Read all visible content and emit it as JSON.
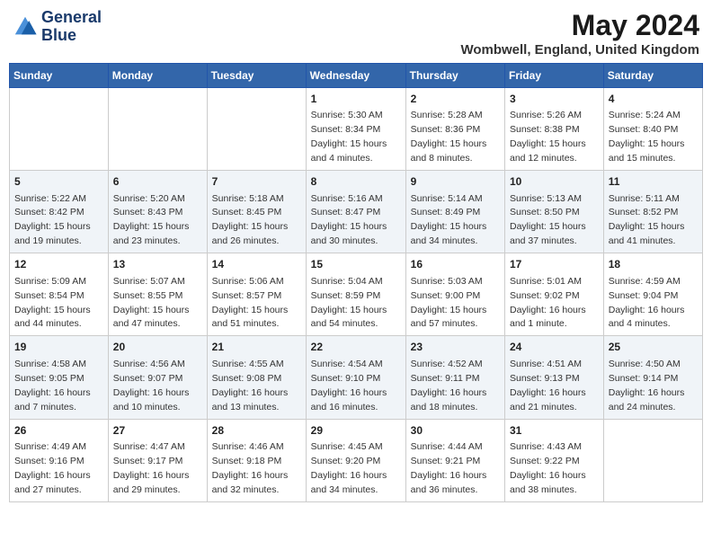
{
  "logo": {
    "line1": "General",
    "line2": "Blue"
  },
  "title": "May 2024",
  "subtitle": "Wombwell, England, United Kingdom",
  "days_of_week": [
    "Sunday",
    "Monday",
    "Tuesday",
    "Wednesday",
    "Thursday",
    "Friday",
    "Saturday"
  ],
  "weeks": [
    [
      {
        "day": null,
        "info": null
      },
      {
        "day": null,
        "info": null
      },
      {
        "day": null,
        "info": null
      },
      {
        "day": "1",
        "info": "Sunrise: 5:30 AM\nSunset: 8:34 PM\nDaylight: 15 hours\nand 4 minutes."
      },
      {
        "day": "2",
        "info": "Sunrise: 5:28 AM\nSunset: 8:36 PM\nDaylight: 15 hours\nand 8 minutes."
      },
      {
        "day": "3",
        "info": "Sunrise: 5:26 AM\nSunset: 8:38 PM\nDaylight: 15 hours\nand 12 minutes."
      },
      {
        "day": "4",
        "info": "Sunrise: 5:24 AM\nSunset: 8:40 PM\nDaylight: 15 hours\nand 15 minutes."
      }
    ],
    [
      {
        "day": "5",
        "info": "Sunrise: 5:22 AM\nSunset: 8:42 PM\nDaylight: 15 hours\nand 19 minutes."
      },
      {
        "day": "6",
        "info": "Sunrise: 5:20 AM\nSunset: 8:43 PM\nDaylight: 15 hours\nand 23 minutes."
      },
      {
        "day": "7",
        "info": "Sunrise: 5:18 AM\nSunset: 8:45 PM\nDaylight: 15 hours\nand 26 minutes."
      },
      {
        "day": "8",
        "info": "Sunrise: 5:16 AM\nSunset: 8:47 PM\nDaylight: 15 hours\nand 30 minutes."
      },
      {
        "day": "9",
        "info": "Sunrise: 5:14 AM\nSunset: 8:49 PM\nDaylight: 15 hours\nand 34 minutes."
      },
      {
        "day": "10",
        "info": "Sunrise: 5:13 AM\nSunset: 8:50 PM\nDaylight: 15 hours\nand 37 minutes."
      },
      {
        "day": "11",
        "info": "Sunrise: 5:11 AM\nSunset: 8:52 PM\nDaylight: 15 hours\nand 41 minutes."
      }
    ],
    [
      {
        "day": "12",
        "info": "Sunrise: 5:09 AM\nSunset: 8:54 PM\nDaylight: 15 hours\nand 44 minutes."
      },
      {
        "day": "13",
        "info": "Sunrise: 5:07 AM\nSunset: 8:55 PM\nDaylight: 15 hours\nand 47 minutes."
      },
      {
        "day": "14",
        "info": "Sunrise: 5:06 AM\nSunset: 8:57 PM\nDaylight: 15 hours\nand 51 minutes."
      },
      {
        "day": "15",
        "info": "Sunrise: 5:04 AM\nSunset: 8:59 PM\nDaylight: 15 hours\nand 54 minutes."
      },
      {
        "day": "16",
        "info": "Sunrise: 5:03 AM\nSunset: 9:00 PM\nDaylight: 15 hours\nand 57 minutes."
      },
      {
        "day": "17",
        "info": "Sunrise: 5:01 AM\nSunset: 9:02 PM\nDaylight: 16 hours\nand 1 minute."
      },
      {
        "day": "18",
        "info": "Sunrise: 4:59 AM\nSunset: 9:04 PM\nDaylight: 16 hours\nand 4 minutes."
      }
    ],
    [
      {
        "day": "19",
        "info": "Sunrise: 4:58 AM\nSunset: 9:05 PM\nDaylight: 16 hours\nand 7 minutes."
      },
      {
        "day": "20",
        "info": "Sunrise: 4:56 AM\nSunset: 9:07 PM\nDaylight: 16 hours\nand 10 minutes."
      },
      {
        "day": "21",
        "info": "Sunrise: 4:55 AM\nSunset: 9:08 PM\nDaylight: 16 hours\nand 13 minutes."
      },
      {
        "day": "22",
        "info": "Sunrise: 4:54 AM\nSunset: 9:10 PM\nDaylight: 16 hours\nand 16 minutes."
      },
      {
        "day": "23",
        "info": "Sunrise: 4:52 AM\nSunset: 9:11 PM\nDaylight: 16 hours\nand 18 minutes."
      },
      {
        "day": "24",
        "info": "Sunrise: 4:51 AM\nSunset: 9:13 PM\nDaylight: 16 hours\nand 21 minutes."
      },
      {
        "day": "25",
        "info": "Sunrise: 4:50 AM\nSunset: 9:14 PM\nDaylight: 16 hours\nand 24 minutes."
      }
    ],
    [
      {
        "day": "26",
        "info": "Sunrise: 4:49 AM\nSunset: 9:16 PM\nDaylight: 16 hours\nand 27 minutes."
      },
      {
        "day": "27",
        "info": "Sunrise: 4:47 AM\nSunset: 9:17 PM\nDaylight: 16 hours\nand 29 minutes."
      },
      {
        "day": "28",
        "info": "Sunrise: 4:46 AM\nSunset: 9:18 PM\nDaylight: 16 hours\nand 32 minutes."
      },
      {
        "day": "29",
        "info": "Sunrise: 4:45 AM\nSunset: 9:20 PM\nDaylight: 16 hours\nand 34 minutes."
      },
      {
        "day": "30",
        "info": "Sunrise: 4:44 AM\nSunset: 9:21 PM\nDaylight: 16 hours\nand 36 minutes."
      },
      {
        "day": "31",
        "info": "Sunrise: 4:43 AM\nSunset: 9:22 PM\nDaylight: 16 hours\nand 38 minutes."
      },
      {
        "day": null,
        "info": null
      }
    ]
  ]
}
